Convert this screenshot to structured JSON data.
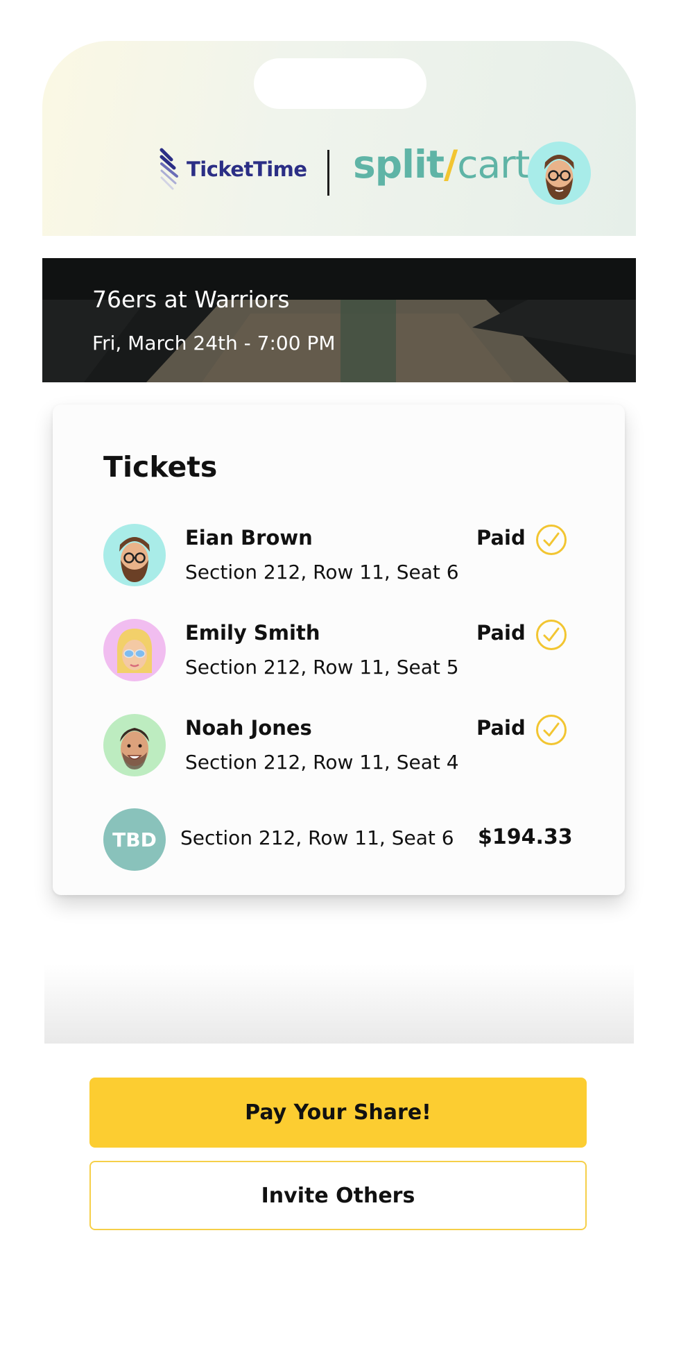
{
  "header": {
    "ticket_brand": "TicketTime",
    "split_brand_part1": "split",
    "split_brand_slash": "/",
    "split_brand_part2": "cart",
    "profile_avatar": "bearded-man-memoji-avatar"
  },
  "event": {
    "title": "76ers at Warriors",
    "datetime": "Fri, March 24th - 7:00 PM"
  },
  "tickets": {
    "heading": "Tickets",
    "rows": [
      {
        "name": "Eian Brown",
        "seat": "Section 212, Row 11, Seat 6",
        "status": "Paid",
        "avatar_color": "#a9ece8"
      },
      {
        "name": "Emily Smith",
        "seat": "Section 212, Row 11, Seat 5",
        "status": "Paid",
        "avatar_color": "#f1bdf0"
      },
      {
        "name": "Noah Jones",
        "seat": "Section 212, Row 11, Seat 4",
        "status": "Paid",
        "avatar_color": "#bdecc0"
      }
    ],
    "open": {
      "badge": "TBD",
      "seat": "Section 212, Row 11, Seat 6",
      "price": "$194.33"
    }
  },
  "actions": {
    "pay_label": "Pay Your Share!",
    "invite_label": "Invite Others"
  },
  "colors": {
    "accent_yellow": "#fccd31",
    "brand_teal": "#5fb4a6",
    "brand_navy": "#2b2e85",
    "check_yellow": "#f2c531"
  }
}
